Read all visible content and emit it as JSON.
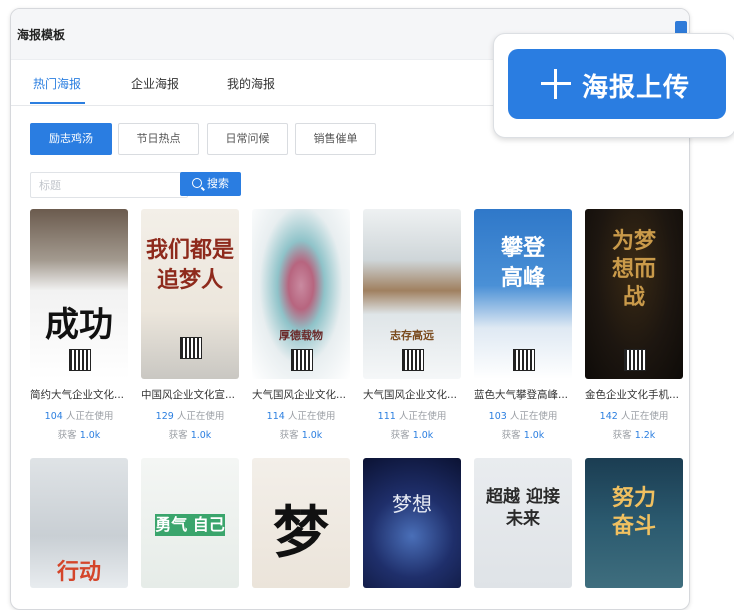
{
  "panel": {
    "title": "海报模板"
  },
  "tabs": [
    {
      "label": "热门海报"
    },
    {
      "label": "企业海报"
    },
    {
      "label": "我的海报"
    }
  ],
  "filters": [
    {
      "label": "励志鸡汤"
    },
    {
      "label": "节日热点"
    },
    {
      "label": "日常问候"
    },
    {
      "label": "销售催单"
    }
  ],
  "search": {
    "placeholder": "标题",
    "button_label": "搜索"
  },
  "upload": {
    "label": "海报上传"
  },
  "templates_row1": [
    {
      "name": "简约大气企业文化...",
      "users": "104",
      "users_suffix": " 人正在使用",
      "fav_label": "获客 ",
      "fav": "1.0k",
      "poster_text": "成功"
    },
    {
      "name": "中国风企业文化宣...",
      "users": "129",
      "users_suffix": " 人正在使用",
      "fav_label": "获客 ",
      "fav": "1.0k",
      "poster_text": "我们都是追梦人"
    },
    {
      "name": "大气国风企业文化...",
      "users": "114",
      "users_suffix": " 人正在使用",
      "fav_label": "获客 ",
      "fav": "1.0k",
      "poster_text": "厚德载物"
    },
    {
      "name": "大气国风企业文化...",
      "users": "111",
      "users_suffix": " 人正在使用",
      "fav_label": "获客 ",
      "fav": "1.0k",
      "poster_text": "志存高远"
    },
    {
      "name": "蓝色大气攀登高峰...",
      "users": "103",
      "users_suffix": " 人正在使用",
      "fav_label": "获客 ",
      "fav": "1.0k",
      "poster_text": "攀登高峰"
    },
    {
      "name": "金色企业文化手机...",
      "users": "142",
      "users_suffix": " 人正在使用",
      "fav_label": "获客 ",
      "fav": "1.2k",
      "poster_text": "为梦想而战"
    }
  ],
  "templates_row2": [
    {
      "poster_text": "行动"
    },
    {
      "poster_text": "勇气 自己"
    },
    {
      "poster_text": "梦"
    },
    {
      "poster_text": "梦想"
    },
    {
      "poster_text": "超越 迎接未来"
    },
    {
      "poster_text": "努力奋斗"
    }
  ],
  "colors": {
    "primary": "#2a7de1",
    "accent_text": "#2c7fe0"
  }
}
